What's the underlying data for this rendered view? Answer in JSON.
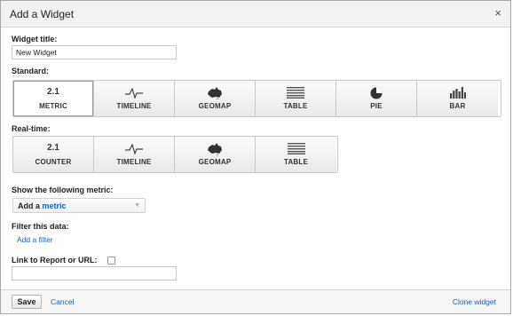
{
  "dialog": {
    "title": "Add a Widget",
    "close_glyph": "×"
  },
  "widget_title": {
    "label": "Widget title:",
    "value": "New Widget"
  },
  "standard": {
    "label": "Standard:",
    "tiles": [
      {
        "label": "METRIC",
        "number": "2.1",
        "icon": "metric-icon",
        "selected": true
      },
      {
        "label": "TIMELINE",
        "icon": "timeline-icon"
      },
      {
        "label": "GEOMAP",
        "icon": "australia-map-icon"
      },
      {
        "label": "TABLE",
        "icon": "table-icon"
      },
      {
        "label": "PIE",
        "icon": "pie-chart-icon"
      },
      {
        "label": "BAR",
        "icon": "bar-chart-icon"
      }
    ]
  },
  "realtime": {
    "label": "Real-time:",
    "tiles": [
      {
        "label": "COUNTER",
        "number": "2.1",
        "icon": "counter-icon"
      },
      {
        "label": "TIMELINE",
        "icon": "timeline-icon"
      },
      {
        "label": "GEOMAP",
        "icon": "australia-map-icon"
      },
      {
        "label": "TABLE",
        "icon": "table-icon"
      }
    ]
  },
  "metric": {
    "label": "Show the following metric:",
    "select_prefix": "Add a",
    "select_link": "metric"
  },
  "filter": {
    "label": "Filter this data:",
    "link": "Add a filter"
  },
  "link_report": {
    "label": "Link to Report or URL:",
    "value": ""
  },
  "footer": {
    "save": "Save",
    "cancel": "Cancel",
    "clone": "Clone widget"
  }
}
